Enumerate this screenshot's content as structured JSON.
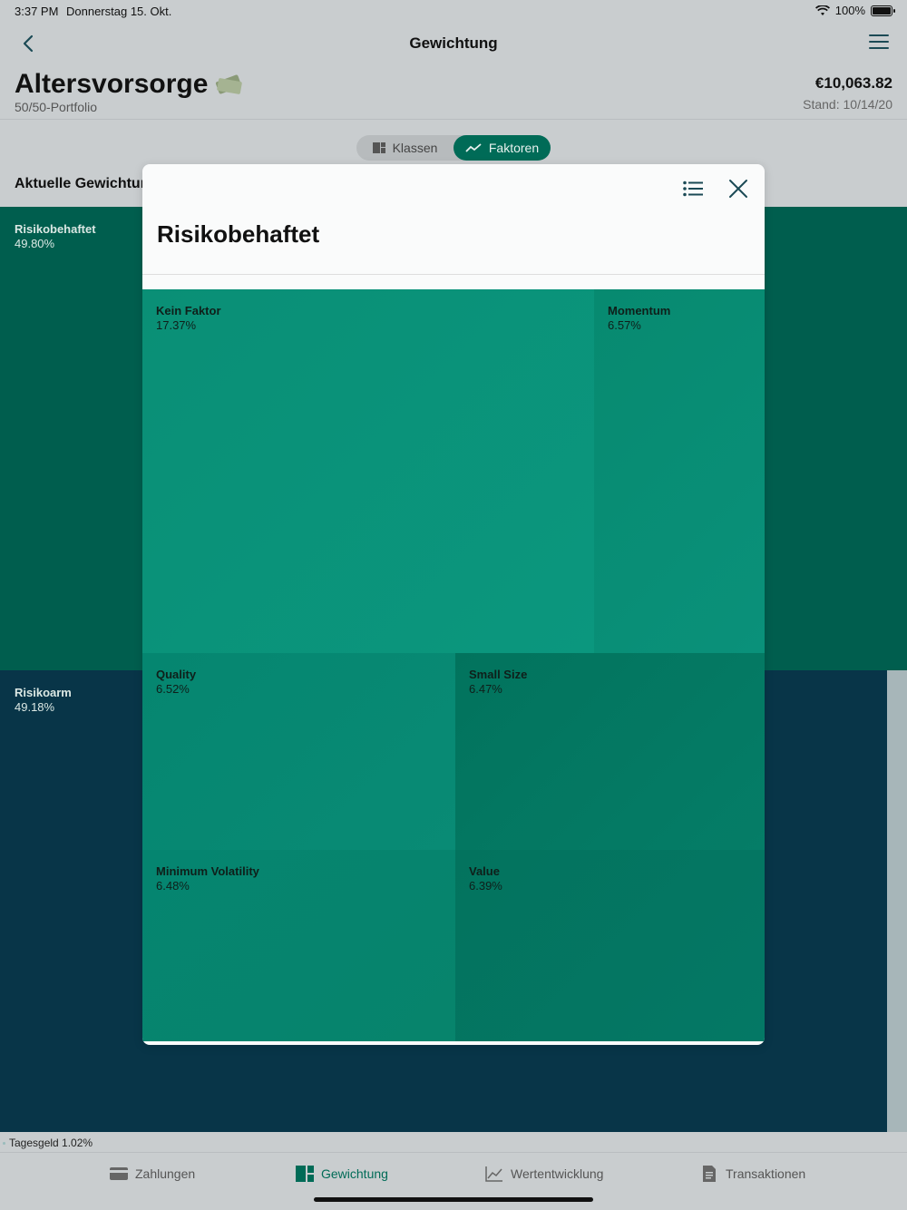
{
  "status": {
    "time": "3:37 PM",
    "date": "Donnerstag 15. Okt.",
    "battery": "100%"
  },
  "nav": {
    "title": "Gewichtung"
  },
  "portfolio": {
    "name": "Altersvorsorge",
    "subtitle": "50/50-Portfolio",
    "value": "€10,063.82",
    "as_of": "Stand: 10/14/20"
  },
  "segment": {
    "classes": "Klassen",
    "factors": "Faktoren",
    "selected": "Faktoren"
  },
  "section": {
    "label": "Aktuelle Gewichtur"
  },
  "background_tree": {
    "risky": {
      "label": "Risikobehaftet",
      "value": "49.80%"
    },
    "low_risk": {
      "label": "Risikoarm",
      "value": "49.18%"
    },
    "cash": {
      "label": "Tagesgeld 1.02%"
    }
  },
  "modal": {
    "title": "Risikobehaftet",
    "tiles": [
      {
        "name": "Kein Faktor",
        "value": "17.37%"
      },
      {
        "name": "Momentum",
        "value": "6.57%"
      },
      {
        "name": "Quality",
        "value": "6.52%"
      },
      {
        "name": "Small Size",
        "value": "6.47%"
      },
      {
        "name": "Minimum Volatility",
        "value": "6.48%"
      },
      {
        "name": "Value",
        "value": "6.39%"
      }
    ]
  },
  "tabs": [
    {
      "label": "Zahlungen"
    },
    {
      "label": "Gewichtung",
      "active": true
    },
    {
      "label": "Wertentwicklung"
    },
    {
      "label": "Transaktionen"
    }
  ],
  "colors": {
    "accent": "#006b57",
    "risky": "#005e4e",
    "low_risk": "#083548",
    "tile_main": "#0a9278",
    "tile_dark": "#047862"
  }
}
